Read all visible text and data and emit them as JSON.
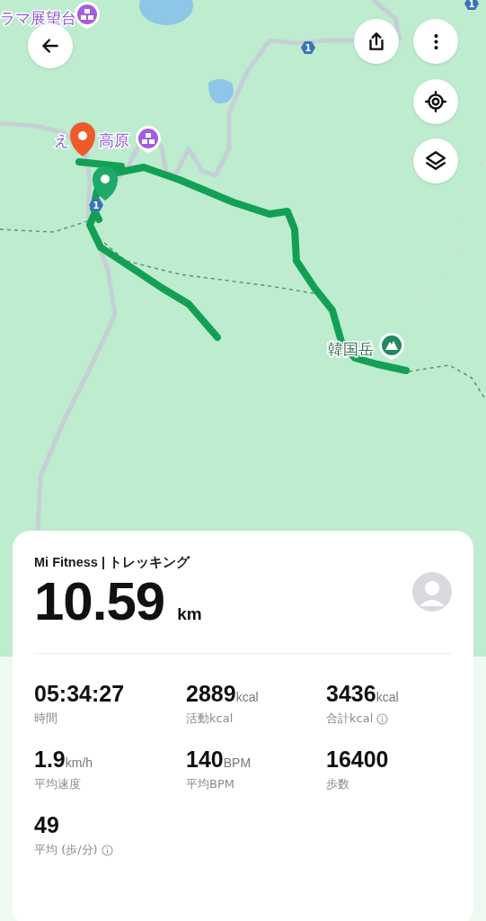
{
  "map": {
    "labels": [
      {
        "text": "ラマ展望台",
        "kind": "poi"
      },
      {
        "text": "え",
        "kind": "plain"
      },
      {
        "text": "高原",
        "kind": "poi"
      },
      {
        "text": "韓国岳",
        "kind": "peak"
      }
    ],
    "road_shields": [
      "1",
      "1",
      "1"
    ]
  },
  "card": {
    "source": "Mi Fitness | トレッキング",
    "distance": "10.59",
    "distance_unit": "km",
    "stats": [
      {
        "value": "05:34:27",
        "label": "時間",
        "info": false
      },
      {
        "value": "2889",
        "unit": "kcal",
        "label": "活動kcal",
        "info": false
      },
      {
        "value": "3436",
        "unit": "kcal",
        "label": "合計kcal",
        "info": true
      },
      {
        "value": "1.9",
        "unit": "km/h",
        "label": "平均速度",
        "info": false
      },
      {
        "value": "140",
        "unit": "BPM",
        "label": "平均BPM",
        "info": false
      },
      {
        "value": "16400",
        "label": "歩数",
        "info": false
      },
      {
        "value": "49",
        "label": "平均 (歩/分)",
        "info": true
      }
    ]
  }
}
